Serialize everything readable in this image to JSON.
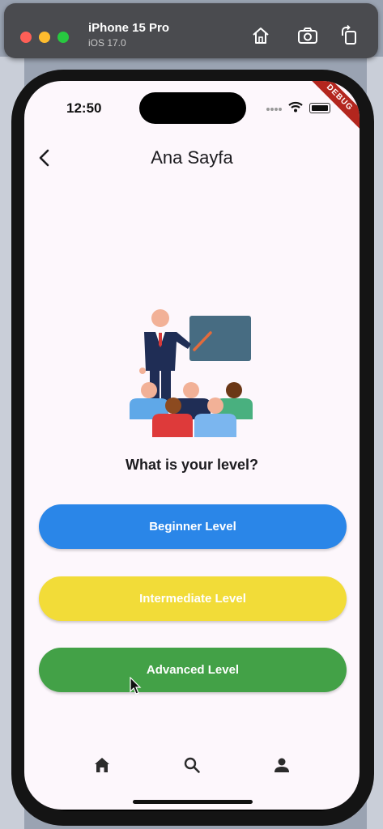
{
  "simulator": {
    "device_name": "iPhone 15 Pro",
    "os_version": "iOS 17.0"
  },
  "status_bar": {
    "time": "12:50"
  },
  "debug_banner": "DEBUG",
  "app_bar": {
    "title": "Ana Sayfa"
  },
  "main": {
    "question": "What is your level?",
    "levels": [
      {
        "label": "Beginner Level",
        "color": "#2a86e8"
      },
      {
        "label": "Intermediate Level",
        "color": "#f2dc38"
      },
      {
        "label": "Advanced Level",
        "color": "#43a147"
      }
    ]
  },
  "bottom_nav": {
    "items": [
      {
        "icon": "home-icon"
      },
      {
        "icon": "search-icon"
      },
      {
        "icon": "person-icon"
      }
    ]
  }
}
